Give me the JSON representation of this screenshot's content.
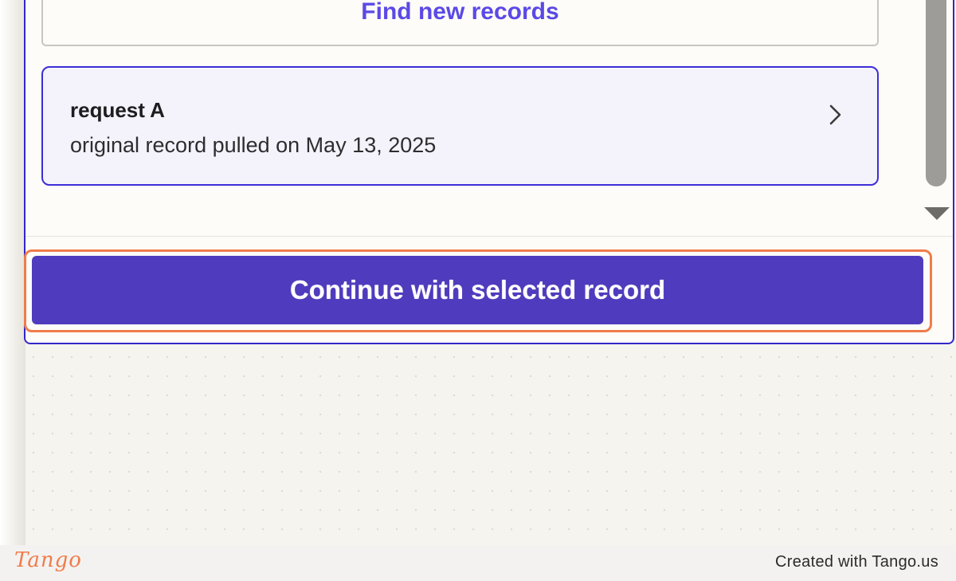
{
  "records_panel": {
    "find_new_label": "Find new records",
    "selected_record": {
      "title": "request A",
      "subtitle": "original record pulled on May 13, 2025",
      "chevron_icon": "chevron-right-icon"
    },
    "continue_label": "Continue with selected record"
  },
  "footer": {
    "logo_text": "Tango",
    "credit_text": "Created with Tango.us"
  },
  "colors": {
    "accent": "#4f3bbd",
    "card_border": "#3c2ed6",
    "highlight": "#f07c4a",
    "link_text": "#5b49e6"
  }
}
